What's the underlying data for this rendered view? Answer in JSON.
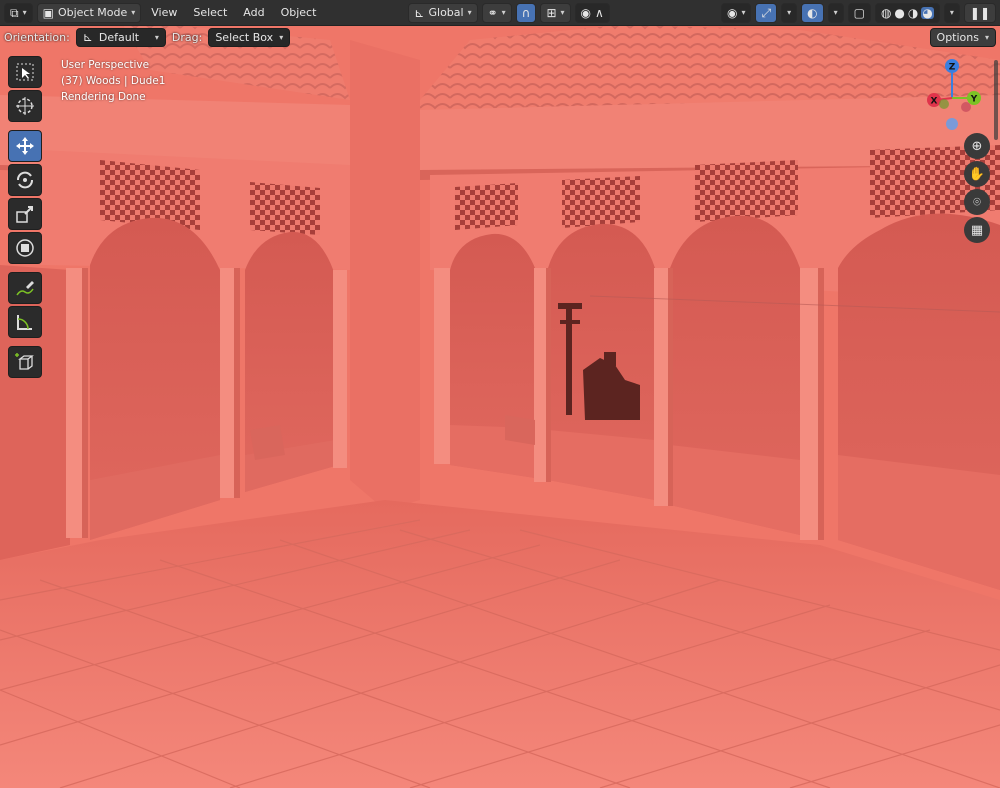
{
  "header": {
    "mode_label": "Object Mode",
    "menus": [
      "View",
      "Select",
      "Add",
      "Object"
    ],
    "transform_orientation": "Global",
    "options_label": "Options"
  },
  "tool_settings": {
    "orientation_label": "Orientation:",
    "orientation_value": "Default",
    "drag_label": "Drag:",
    "drag_value": "Select Box"
  },
  "viewport_info": {
    "perspective": "User Perspective",
    "collection": "(37) Woods | Dude1",
    "status": "Rendering Done"
  },
  "gizmo": {
    "axis_z": "Z",
    "axis_y": "Y",
    "axis_x": "X",
    "color_x": "#e0344b",
    "color_y": "#7cc225",
    "color_z": "#3a7fe0"
  },
  "tools": [
    "select-box",
    "cursor",
    "move",
    "rotate",
    "scale",
    "transform",
    "annotate",
    "measure",
    "add-cube"
  ],
  "colors": {
    "accent": "#4772b3",
    "scene_tint": "#f07a6c"
  }
}
